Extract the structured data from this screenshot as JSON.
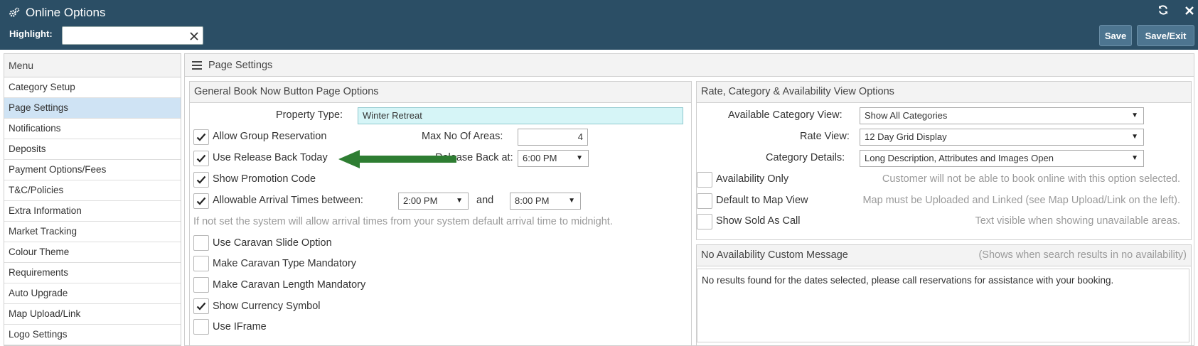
{
  "window": {
    "title": "Online Options",
    "title_icon": "gears-icon",
    "refresh_icon": "refresh-icon",
    "close_icon": "close-icon"
  },
  "toolbar": {
    "highlight_label": "Highlight:",
    "highlight_value": "",
    "save_label": "Save",
    "save_exit_label": "Save/Exit"
  },
  "colors": {
    "header_bg": "#2b4e65",
    "button_bg": "#4d7590",
    "active_menu_bg": "#cfe3f4",
    "property_input_bg": "#d6f5f7",
    "arrow_green": "#2e7d32"
  },
  "menu": {
    "title": "Menu",
    "items": [
      {
        "label": "Category Setup",
        "active": false
      },
      {
        "label": "Page Settings",
        "active": true
      },
      {
        "label": "Notifications",
        "active": false
      },
      {
        "label": "Deposits",
        "active": false
      },
      {
        "label": "Payment Options/Fees",
        "active": false
      },
      {
        "label": "T&C/Policies",
        "active": false
      },
      {
        "label": "Extra Information",
        "active": false
      },
      {
        "label": "Market Tracking",
        "active": false
      },
      {
        "label": "Colour Theme",
        "active": false
      },
      {
        "label": "Requirements",
        "active": false
      },
      {
        "label": "Auto Upgrade",
        "active": false
      },
      {
        "label": "Map Upload/Link",
        "active": false
      },
      {
        "label": "Logo Settings",
        "active": false
      }
    ]
  },
  "main": {
    "title": "Page Settings"
  },
  "general": {
    "title": "General Book Now Button Page Options",
    "property_type_label": "Property Type:",
    "property_type_value": "Winter Retreat",
    "allow_group_label": "Allow Group Reservation",
    "allow_group_checked": true,
    "max_areas_label": "Max No Of Areas:",
    "max_areas_value": "4",
    "use_release_label": "Use Release Back Today",
    "use_release_checked": true,
    "release_back_label": "Release Back at:",
    "release_back_value": "6:00 PM",
    "show_promo_label": "Show Promotion Code",
    "show_promo_checked": true,
    "arrival_label": "Allowable Arrival Times between:",
    "arrival_checked": true,
    "arrival_from": "2:00 PM",
    "arrival_and": "and",
    "arrival_to": "8:00 PM",
    "arrival_hint": "If not set the system will allow arrival times from your system default arrival time to midnight.",
    "caravan_slide_label": "Use Caravan Slide Option",
    "caravan_slide_checked": false,
    "caravan_type_label": "Make Caravan Type Mandatory",
    "caravan_type_checked": false,
    "caravan_length_label": "Make Caravan Length Mandatory",
    "caravan_length_checked": false,
    "currency_label": "Show Currency Symbol",
    "currency_checked": true,
    "iframe_label": "Use IFrame",
    "iframe_checked": false
  },
  "rate": {
    "title": "Rate, Category & Availability View Options",
    "category_view_label": "Available Category View:",
    "category_view_value": "Show All Categories",
    "rate_view_label": "Rate View:",
    "rate_view_value": "12 Day Grid Display",
    "category_details_label": "Category Details:",
    "category_details_value": "Long Description, Attributes and Images Open",
    "availability_only_label": "Availability Only",
    "availability_only_checked": false,
    "availability_only_hint": "Customer will not be able to book online with this option selected.",
    "map_view_label": "Default to Map View",
    "map_view_checked": false,
    "map_view_hint": "Map must be Uploaded and Linked (see Map Upload/Link on the left).",
    "sold_as_call_label": "Show Sold As Call",
    "sold_as_call_checked": false,
    "sold_as_call_hint": "Text visible when showing unavailable areas."
  },
  "no_availability": {
    "title": "No Availability Custom Message",
    "hint": "(Shows when search results in no availability)",
    "message": "No results found for the dates selected, please call reservations for assistance with your booking."
  }
}
